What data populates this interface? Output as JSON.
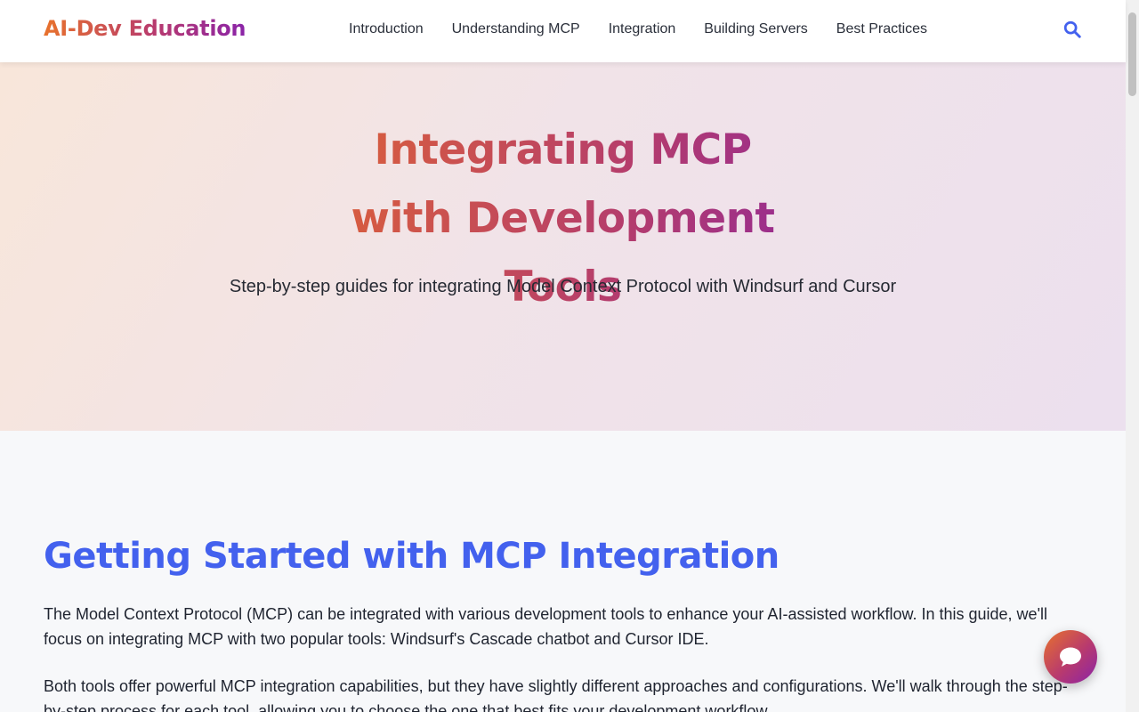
{
  "header": {
    "logo": "AI-Dev Education",
    "nav": [
      "Introduction",
      "Understanding MCP",
      "Integration",
      "Building Servers",
      "Best Practices"
    ],
    "search_icon": "search-icon"
  },
  "hero": {
    "title": "Integrating MCP with Development Tools",
    "subtitle": "Step-by-step guides for integrating Model Context Protocol with Windsurf and Cursor"
  },
  "content": {
    "heading": "Getting Started with MCP Integration",
    "paragraph1": "The Model Context Protocol (MCP) can be integrated with various development tools to enhance your AI-assisted workflow. In this guide, we'll focus on integrating MCP with two popular tools: Windsurf's Cascade chatbot and Cursor IDE.",
    "paragraph2": "Both tools offer powerful MCP integration capabilities, but they have slightly different approaches and configurations. We'll walk through the step-by-step process for each tool, allowing you to choose the one that best fits your development workflow."
  },
  "chat": {
    "icon": "chat-bubble-icon"
  },
  "colors": {
    "accent": "#4361ee",
    "brand_start": "#e8722c",
    "brand_end": "#8a23a8"
  }
}
